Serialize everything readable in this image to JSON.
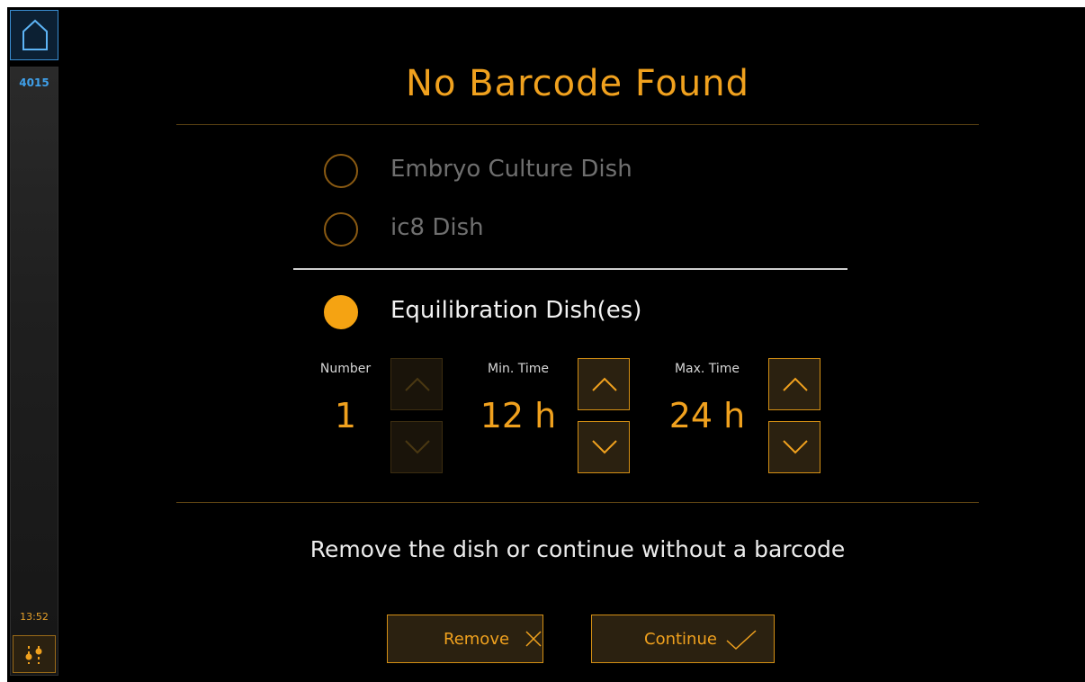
{
  "sidebar": {
    "device_id": "4015",
    "clock": "13:52",
    "home_icon": "home-icon",
    "settings_icon": "sliders-icon"
  },
  "dialog": {
    "title": "No Barcode Found",
    "options": [
      {
        "label": "Embryo Culture Dish",
        "selected": false,
        "enabled": false
      },
      {
        "label": "ic8 Dish",
        "selected": false,
        "enabled": false
      },
      {
        "label": "Equilibration Dish(es)",
        "selected": true,
        "enabled": true
      }
    ],
    "fields": {
      "number": {
        "label": "Number",
        "value": "1"
      },
      "min_time": {
        "label": "Min. Time",
        "value": "12 h"
      },
      "max_time": {
        "label": "Max. Time",
        "value": "24 h"
      }
    },
    "message": "Remove the dish or continue without a barcode",
    "buttons": {
      "remove": "Remove",
      "continue": "Continue"
    }
  },
  "colors": {
    "accent": "#f0a11e",
    "background": "#000000",
    "sidebar_accent": "#3fa0ea"
  }
}
